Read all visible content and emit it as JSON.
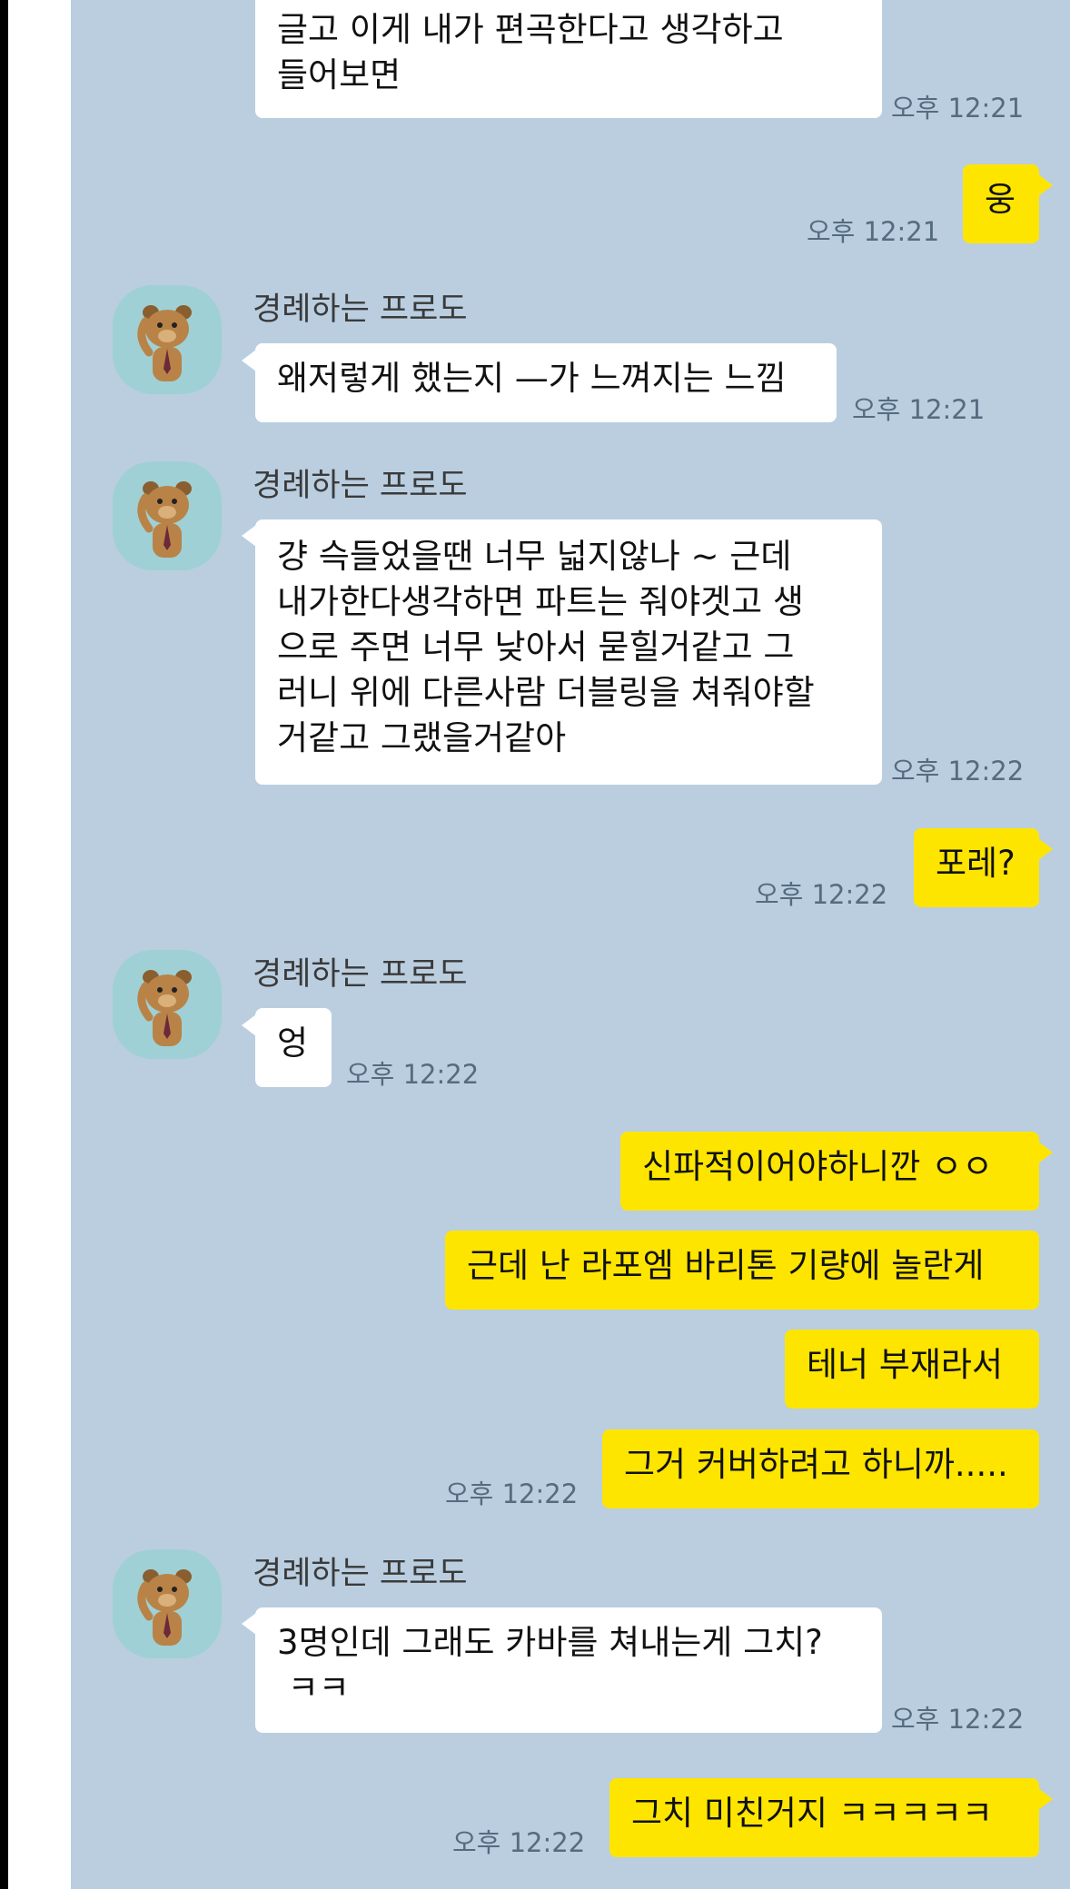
{
  "chat": {
    "sender_name": "경례하는 프로도",
    "messages": [
      {
        "dir": "in",
        "text": "글고 이게 내가 편곡한다고 생각하고\n들어보면",
        "time": "오후 12:21"
      },
      {
        "dir": "out",
        "text": "웅",
        "time": "오후 12:21"
      },
      {
        "dir": "in",
        "sender": "경례하는 프로도",
        "text": "왜저렇게 했는지 —가 느껴지는 느낌",
        "time": "오후 12:21"
      },
      {
        "dir": "in",
        "sender": "경례하는 프로도",
        "text": "걍 슥들었을땐 너무 넓지않나 ~ 근데\n내가한다생각하면 파트는 줘야겟고 생\n으로 주면 너무 낮아서 묻힐거같고 그\n러니 위에 다른사람 더블링을 쳐줘야할\n거같고 그랬을거같아",
        "time": "오후 12:22"
      },
      {
        "dir": "out",
        "text": "포레?",
        "time": "오후 12:22"
      },
      {
        "dir": "in",
        "sender": "경례하는 프로도",
        "text": "엉",
        "time": "오후 12:22"
      },
      {
        "dir": "out",
        "text": "신파적이어야하니깐 ㅇㅇ",
        "time": ""
      },
      {
        "dir": "out",
        "text": "근데 난 라포엠 바리톤 기량에 놀란게",
        "time": ""
      },
      {
        "dir": "out",
        "text": "테너 부재라서",
        "time": ""
      },
      {
        "dir": "out",
        "text": "그거 커버하려고 하니까.....",
        "time": "오후 12:22"
      },
      {
        "dir": "in",
        "sender": "경례하는 프로도",
        "text": "3명인데 그래도 카바를 쳐내는게 그치?\n ㅋㅋ",
        "time": "오후 12:22"
      },
      {
        "dir": "out",
        "text": "그치 미친거지 ㅋㅋㅋㅋㅋ",
        "time": "오후 12:22"
      }
    ]
  },
  "colors": {
    "background": "#bacee0",
    "bubble_out": "#fee500",
    "bubble_in": "#ffffff",
    "avatar_bg": "#9fd0d6"
  },
  "icons": {
    "avatar": "bear-saluting-icon"
  }
}
